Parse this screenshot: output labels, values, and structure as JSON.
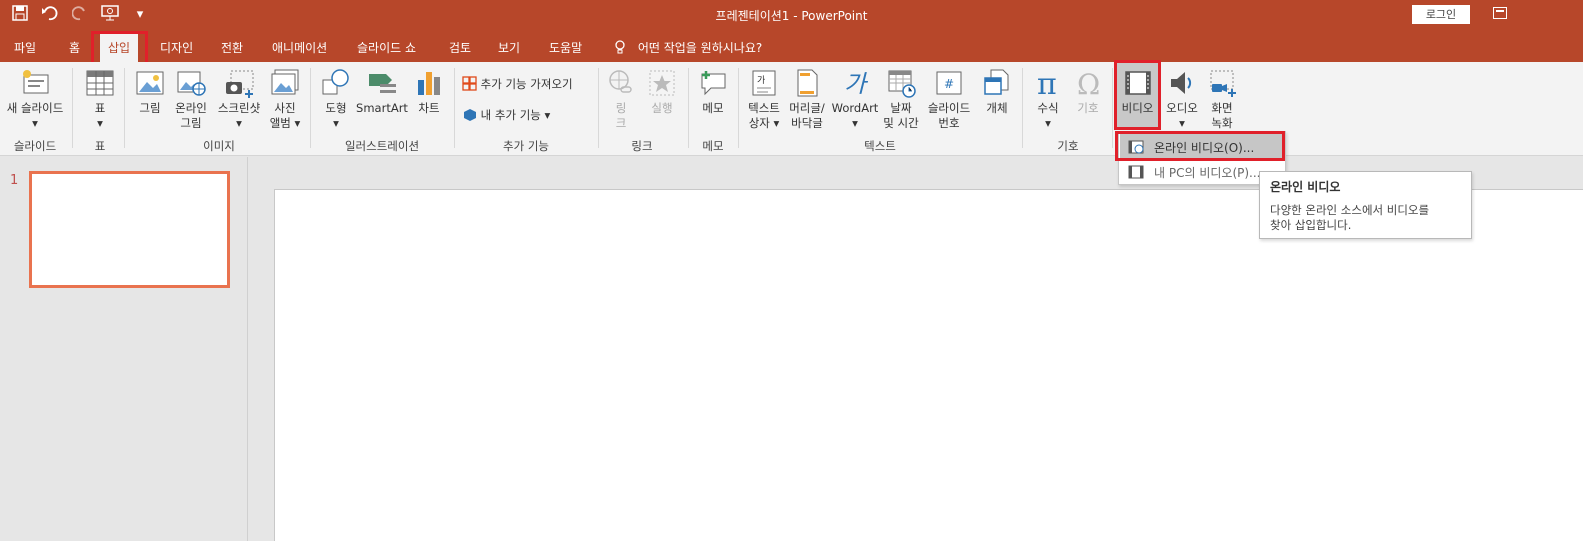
{
  "window": {
    "title": "프레젠테이션1  -  PowerPoint",
    "login_label": "로그인"
  },
  "qat": {
    "save": "save-icon",
    "undo": "undo-icon",
    "redo": "redo-icon",
    "start_slideshow": "slideshow-start-icon",
    "customize": "▾"
  },
  "tabs": [
    "파일",
    "홈",
    "삽입",
    "디자인",
    "전환",
    "애니메이션",
    "슬라이드 쇼",
    "검토",
    "보기",
    "도움말"
  ],
  "active_tab": "삽입",
  "tell_me": "어떤 작업을 원하시나요?",
  "ribbon": {
    "new_slide": "새 슬라이드",
    "table": "표",
    "picture": "그림",
    "online_picture_1": "온라인",
    "online_picture_2": "그림",
    "screenshot": "스크린샷",
    "photo_album_1": "사진",
    "photo_album_2": "앨범",
    "shapes": "도형",
    "smartart": "SmartArt",
    "chart": "차트",
    "get_addins": "추가 기능 가져오기",
    "my_addins": "내 추가 기능",
    "link_1": "링",
    "link_2": "크",
    "action": "실행",
    "comment": "메모",
    "textbox_1": "텍스트",
    "textbox_2": "상자",
    "header_footer_1": "머리글/",
    "header_footer_2": "바닥글",
    "wordart": "WordArt",
    "datetime_1": "날짜",
    "datetime_2": "및 시간",
    "slide_number_1": "슬라이드",
    "slide_number_2": "번호",
    "object": "개체",
    "equation": "수식",
    "symbol": "기호",
    "video": "비디오",
    "audio": "오디오",
    "screen_recording_1": "화면",
    "screen_recording_2": "녹화",
    "groups": {
      "slides": "슬라이드",
      "tables": "표",
      "images": "이미지",
      "illustrations": "일러스트레이션",
      "addins": "추가 기능",
      "links": "링크",
      "comments": "메모",
      "text": "텍스트",
      "symbols": "기호"
    }
  },
  "slides_pane": {
    "slide_number": "1"
  },
  "video_menu": {
    "online_video": "온라인 비디오(O)...",
    "pc_video": "내 PC의 비디오(P)..."
  },
  "tooltip": {
    "title": "온라인 비디오",
    "body_line1": "다양한 온라인 소스에서 비디오를",
    "body_line2": "찾아 삽입합니다."
  },
  "colors": {
    "accent": "#b7472a",
    "highlight_red": "#e0202a",
    "thumb_border": "#e9734f"
  }
}
